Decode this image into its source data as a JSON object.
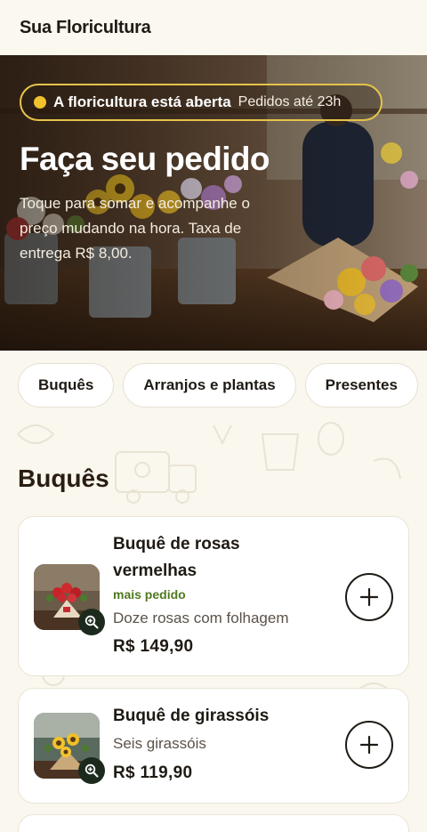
{
  "header": {
    "brand": "Sua Floricultura"
  },
  "hero": {
    "status_main": "A floricultura está aberta",
    "status_sub": "Pedidos até 23h",
    "title": "Faça seu pedido",
    "description": "Toque para somar e acompanhe o preço mudando na hora. Taxa de entrega R$ 8,00."
  },
  "categories": [
    "Buquês",
    "Arranjos e plantas",
    "Presentes"
  ],
  "section": {
    "title": "Buquês"
  },
  "products": [
    {
      "name": "Buquê de rosas vermelhas",
      "badge": "mais pedido",
      "description": "Doze rosas com folhagem",
      "price": "R$ 149,90"
    },
    {
      "name": "Buquê de girassóis",
      "description": "Seis girassóis",
      "price": "R$ 119,90"
    }
  ],
  "icons": {
    "status": "status-dot-icon",
    "zoom": "zoom-in-icon",
    "add": "plus-icon"
  },
  "colors": {
    "accent_yellow": "#f2c12e",
    "badge_green": "#4f7a1f",
    "zoom_button": "#1c2a1d",
    "background": "#faf7ef"
  }
}
